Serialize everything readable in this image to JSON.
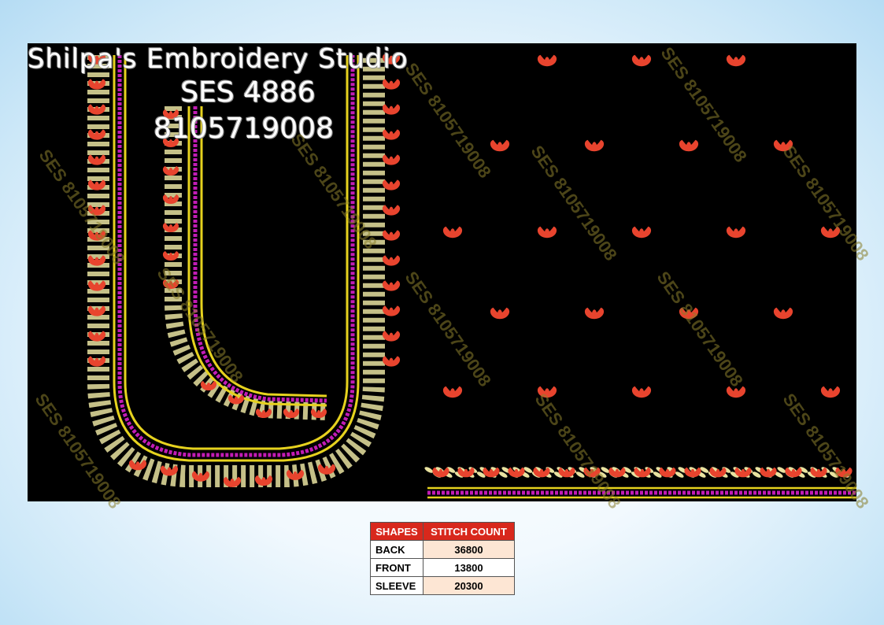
{
  "studio": {
    "name": "Shilpa's Embroidery Studio",
    "code": "SES 4886",
    "phone": "8105719008"
  },
  "watermark": "SES 8105719008",
  "table": {
    "headers": [
      "SHAPES",
      "STITCH COUNT"
    ],
    "rows": [
      {
        "shape": "BACK",
        "count": "36800"
      },
      {
        "shape": "FRONT",
        "count": "13800"
      },
      {
        "shape": "SLEEVE",
        "count": "20300"
      }
    ]
  },
  "colors": {
    "background": "#000000",
    "flower_red": "#e8442e",
    "leaf_cream": "#e8e2a0",
    "border_yellow": "#e6d21e",
    "bead_magenta": "#c21cb5",
    "header_red": "#d8281c"
  }
}
